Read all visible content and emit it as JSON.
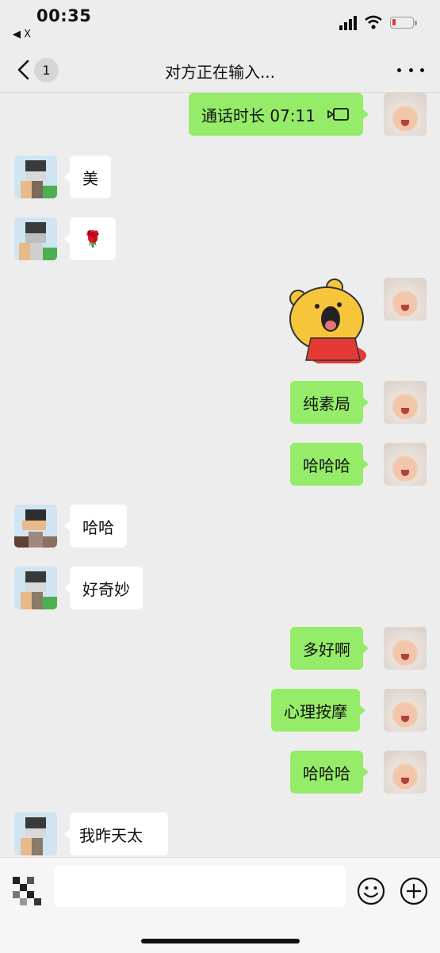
{
  "status_bar": {
    "time": "00:35",
    "back_app": "◀ X"
  },
  "nav": {
    "title": "对方正在输入...",
    "unread_badge": "1"
  },
  "messages": [
    {
      "side": "me",
      "type": "call",
      "text": "通话时长 07:11",
      "icon": "video-call-icon"
    },
    {
      "side": "other",
      "type": "text",
      "text": "美"
    },
    {
      "side": "other",
      "type": "emoji",
      "text": "🌹",
      "icon": "rose-emoji"
    },
    {
      "side": "me",
      "type": "sticker",
      "icon": "yellow-bear-sticker"
    },
    {
      "side": "me",
      "type": "text",
      "text": "纯素局"
    },
    {
      "side": "me",
      "type": "text",
      "text": "哈哈哈"
    },
    {
      "side": "other",
      "type": "text",
      "text": "哈哈"
    },
    {
      "side": "other",
      "type": "text",
      "text": "好奇妙"
    },
    {
      "side": "me",
      "type": "text",
      "text": "多好啊"
    },
    {
      "side": "me",
      "type": "text",
      "text": "心理按摩"
    },
    {
      "side": "me",
      "type": "text",
      "text": "哈哈哈"
    },
    {
      "side": "other",
      "type": "text",
      "text": "我昨天太"
    }
  ],
  "input": {
    "value": "",
    "placeholder": ""
  },
  "colors": {
    "background": "#ededed",
    "my_bubble": "#95ec69",
    "other_bubble": "#ffffff",
    "battery_low": "#e53935"
  }
}
